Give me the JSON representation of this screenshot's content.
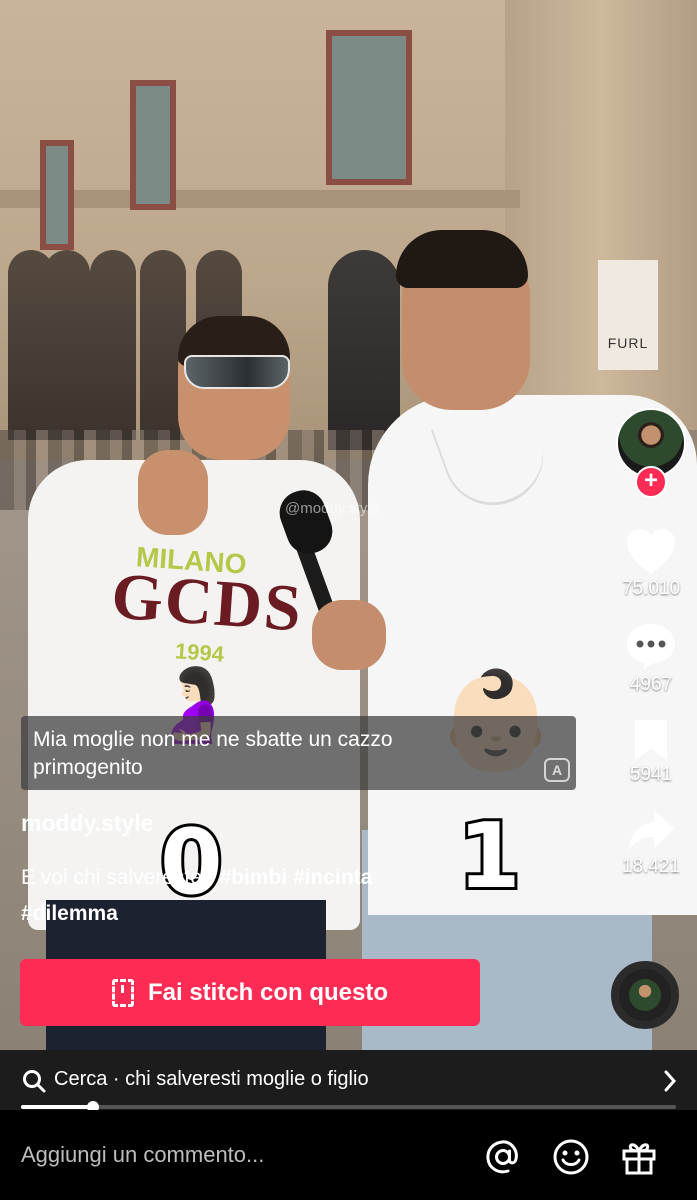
{
  "video": {
    "watermark": "@moddy.style",
    "shirt_text_top": "MILANO",
    "shirt_text_main": "GCDS",
    "shirt_text_year": "1994",
    "store_sign": "FURL",
    "left_emoji": "🤰🏻",
    "right_emoji": "👶🏻",
    "left_count": "0",
    "right_count": "1"
  },
  "caption": {
    "line1": "Mia moglie non me ne sbatte un cazzo",
    "line2": "primogenito"
  },
  "rail": {
    "likes": "75.010",
    "comments": "4967",
    "saves": "5941",
    "shares": "18.421",
    "follow_glyph": "+"
  },
  "post": {
    "author": "moddy.style",
    "description": "E voi chi salvereste?",
    "hashtags": [
      "#bimbi",
      "#incinta",
      "#dilemma"
    ]
  },
  "stitch": {
    "label": "Fai stitch con questo"
  },
  "search": {
    "text": "Cerca · chi salveresti moglie o figlio"
  },
  "playback": {
    "progress": 0.11
  },
  "comment": {
    "placeholder": "Aggiungi un commento..."
  },
  "colors": {
    "accent": "#fe2c55",
    "bar": "#1c1c1c"
  }
}
